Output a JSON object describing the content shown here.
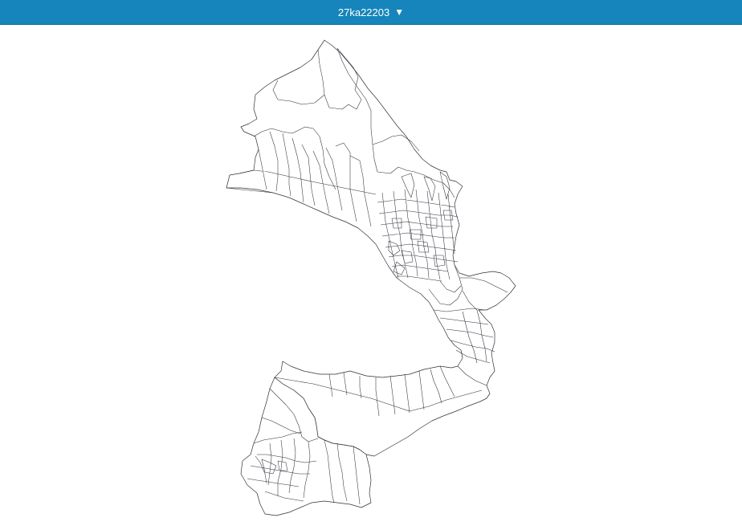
{
  "header": {
    "map_selector_label": "27ka22203",
    "dropdown_glyph": "▼",
    "background_color": "#1585bb",
    "text_color": "#ffffff"
  },
  "map": {
    "boundary_color": "#2f2f3a",
    "fill_color": "#ffffff"
  }
}
